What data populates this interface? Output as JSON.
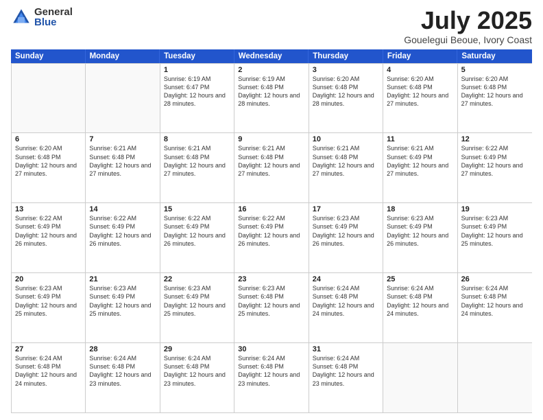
{
  "logo": {
    "general": "General",
    "blue": "Blue"
  },
  "title": {
    "month": "July 2025",
    "location": "Gouelegui Beoue, Ivory Coast"
  },
  "weekdays": [
    "Sunday",
    "Monday",
    "Tuesday",
    "Wednesday",
    "Thursday",
    "Friday",
    "Saturday"
  ],
  "weeks": [
    [
      {
        "day": "",
        "info": ""
      },
      {
        "day": "",
        "info": ""
      },
      {
        "day": "1",
        "info": "Sunrise: 6:19 AM\nSunset: 6:47 PM\nDaylight: 12 hours and 28 minutes."
      },
      {
        "day": "2",
        "info": "Sunrise: 6:19 AM\nSunset: 6:48 PM\nDaylight: 12 hours and 28 minutes."
      },
      {
        "day": "3",
        "info": "Sunrise: 6:20 AM\nSunset: 6:48 PM\nDaylight: 12 hours and 28 minutes."
      },
      {
        "day": "4",
        "info": "Sunrise: 6:20 AM\nSunset: 6:48 PM\nDaylight: 12 hours and 27 minutes."
      },
      {
        "day": "5",
        "info": "Sunrise: 6:20 AM\nSunset: 6:48 PM\nDaylight: 12 hours and 27 minutes."
      }
    ],
    [
      {
        "day": "6",
        "info": "Sunrise: 6:20 AM\nSunset: 6:48 PM\nDaylight: 12 hours and 27 minutes."
      },
      {
        "day": "7",
        "info": "Sunrise: 6:21 AM\nSunset: 6:48 PM\nDaylight: 12 hours and 27 minutes."
      },
      {
        "day": "8",
        "info": "Sunrise: 6:21 AM\nSunset: 6:48 PM\nDaylight: 12 hours and 27 minutes."
      },
      {
        "day": "9",
        "info": "Sunrise: 6:21 AM\nSunset: 6:48 PM\nDaylight: 12 hours and 27 minutes."
      },
      {
        "day": "10",
        "info": "Sunrise: 6:21 AM\nSunset: 6:48 PM\nDaylight: 12 hours and 27 minutes."
      },
      {
        "day": "11",
        "info": "Sunrise: 6:21 AM\nSunset: 6:49 PM\nDaylight: 12 hours and 27 minutes."
      },
      {
        "day": "12",
        "info": "Sunrise: 6:22 AM\nSunset: 6:49 PM\nDaylight: 12 hours and 27 minutes."
      }
    ],
    [
      {
        "day": "13",
        "info": "Sunrise: 6:22 AM\nSunset: 6:49 PM\nDaylight: 12 hours and 26 minutes."
      },
      {
        "day": "14",
        "info": "Sunrise: 6:22 AM\nSunset: 6:49 PM\nDaylight: 12 hours and 26 minutes."
      },
      {
        "day": "15",
        "info": "Sunrise: 6:22 AM\nSunset: 6:49 PM\nDaylight: 12 hours and 26 minutes."
      },
      {
        "day": "16",
        "info": "Sunrise: 6:22 AM\nSunset: 6:49 PM\nDaylight: 12 hours and 26 minutes."
      },
      {
        "day": "17",
        "info": "Sunrise: 6:23 AM\nSunset: 6:49 PM\nDaylight: 12 hours and 26 minutes."
      },
      {
        "day": "18",
        "info": "Sunrise: 6:23 AM\nSunset: 6:49 PM\nDaylight: 12 hours and 26 minutes."
      },
      {
        "day": "19",
        "info": "Sunrise: 6:23 AM\nSunset: 6:49 PM\nDaylight: 12 hours and 25 minutes."
      }
    ],
    [
      {
        "day": "20",
        "info": "Sunrise: 6:23 AM\nSunset: 6:49 PM\nDaylight: 12 hours and 25 minutes."
      },
      {
        "day": "21",
        "info": "Sunrise: 6:23 AM\nSunset: 6:49 PM\nDaylight: 12 hours and 25 minutes."
      },
      {
        "day": "22",
        "info": "Sunrise: 6:23 AM\nSunset: 6:49 PM\nDaylight: 12 hours and 25 minutes."
      },
      {
        "day": "23",
        "info": "Sunrise: 6:23 AM\nSunset: 6:48 PM\nDaylight: 12 hours and 25 minutes."
      },
      {
        "day": "24",
        "info": "Sunrise: 6:24 AM\nSunset: 6:48 PM\nDaylight: 12 hours and 24 minutes."
      },
      {
        "day": "25",
        "info": "Sunrise: 6:24 AM\nSunset: 6:48 PM\nDaylight: 12 hours and 24 minutes."
      },
      {
        "day": "26",
        "info": "Sunrise: 6:24 AM\nSunset: 6:48 PM\nDaylight: 12 hours and 24 minutes."
      }
    ],
    [
      {
        "day": "27",
        "info": "Sunrise: 6:24 AM\nSunset: 6:48 PM\nDaylight: 12 hours and 24 minutes."
      },
      {
        "day": "28",
        "info": "Sunrise: 6:24 AM\nSunset: 6:48 PM\nDaylight: 12 hours and 23 minutes."
      },
      {
        "day": "29",
        "info": "Sunrise: 6:24 AM\nSunset: 6:48 PM\nDaylight: 12 hours and 23 minutes."
      },
      {
        "day": "30",
        "info": "Sunrise: 6:24 AM\nSunset: 6:48 PM\nDaylight: 12 hours and 23 minutes."
      },
      {
        "day": "31",
        "info": "Sunrise: 6:24 AM\nSunset: 6:48 PM\nDaylight: 12 hours and 23 minutes."
      },
      {
        "day": "",
        "info": ""
      },
      {
        "day": "",
        "info": ""
      }
    ]
  ]
}
